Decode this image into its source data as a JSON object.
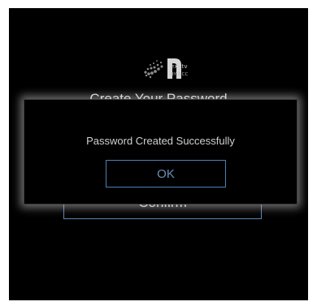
{
  "logo": {
    "brand": "exxtv",
    "byline": "BY NCC"
  },
  "page": {
    "title": "Create Your Password",
    "confirm_label": "Confirm"
  },
  "dialog": {
    "message": "Password Created Successfully",
    "ok_label": "OK"
  },
  "colors": {
    "background": "#000000",
    "accent_border": "#4f7fb5",
    "text": "#d0d0d0"
  }
}
